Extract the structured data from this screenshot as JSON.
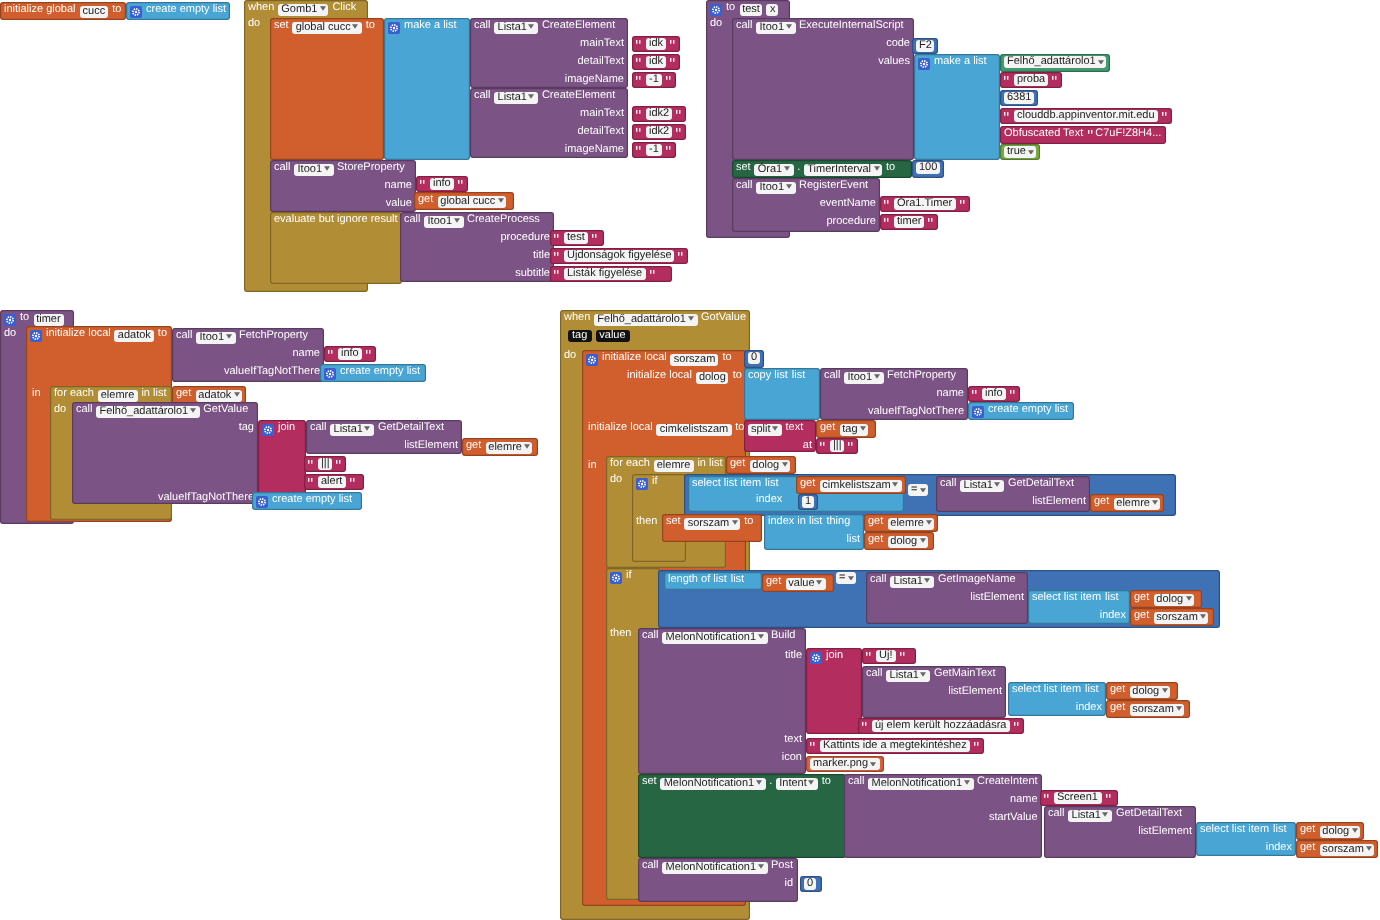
{
  "blocks": [
    {
      "pieces": [
        {
          "kind": "variable",
          "lines": [
            [
              "initialize global",
              {
                "kind": "name",
                "text": "cucc"
              },
              "to"
            ]
          ]
        },
        {
          "kind": "list",
          "lines": [
            [
              {
                "kind": "gear"
              },
              "create empty list"
            ]
          ]
        }
      ]
    },
    {
      "pieces": [
        {
          "kind": "event",
          "lines": [
            [
              "when",
              {
                "kind": "dropdown",
                "text": "Gomb1"
              },
              "Click"
            ],
            [
              "do"
            ]
          ]
        },
        {
          "kind": "variable",
          "lines": [
            [
              "set",
              {
                "kind": "dropdown",
                "text": "global cucc"
              },
              "to"
            ]
          ]
        },
        {
          "kind": "list",
          "lines": [
            [
              {
                "kind": "gear"
              },
              "make a list"
            ]
          ]
        },
        {
          "kind": "call",
          "lines": [
            [
              "call",
              {
                "kind": "dropdown",
                "text": "Lista1"
              },
              "CreateElement"
            ],
            [
              "mainText"
            ],
            [
              "detailText"
            ],
            [
              "imageName"
            ]
          ]
        },
        {
          "kind": "string",
          "text": "idk"
        },
        {
          "kind": "string",
          "text": "idk"
        },
        {
          "kind": "string",
          "text": "-1"
        },
        {
          "kind": "call",
          "lines": [
            [
              "call",
              {
                "kind": "dropdown",
                "text": "Lista1"
              },
              "CreateElement"
            ],
            [
              "mainText"
            ],
            [
              "detailText"
            ],
            [
              "imageName"
            ]
          ]
        },
        {
          "kind": "string",
          "text": "idk2"
        },
        {
          "kind": "string",
          "text": "idk2"
        },
        {
          "kind": "string",
          "text": "-1"
        },
        {
          "kind": "call",
          "lines": [
            [
              "call",
              {
                "kind": "dropdown",
                "text": "Itoo1"
              },
              "StoreProperty"
            ],
            [
              "name"
            ],
            [
              "value"
            ]
          ]
        },
        {
          "kind": "string",
          "text": "info"
        },
        {
          "kind": "variable",
          "lines": [
            [
              "get",
              {
                "kind": "dropdown",
                "text": "global cucc"
              }
            ]
          ]
        },
        {
          "kind": "control",
          "lines": [
            [
              "evaluate but ignore result"
            ]
          ]
        },
        {
          "kind": "call",
          "lines": [
            [
              "call",
              {
                "kind": "dropdown",
                "text": "Itoo1"
              },
              "CreateProcess"
            ],
            [
              "procedure"
            ],
            [
              "title"
            ],
            [
              "subtitle"
            ]
          ]
        },
        {
          "kind": "string",
          "text": "test"
        },
        {
          "kind": "string",
          "text": "Újdonságok figyelése"
        },
        {
          "kind": "string",
          "text": "Listák figyelése"
        }
      ]
    },
    {
      "pieces": [
        {
          "kind": "procedure",
          "lines": [
            [
              {
                "kind": "gear"
              },
              "to",
              {
                "kind": "name",
                "text": "test"
              },
              {
                "kind": "name",
                "text": "x"
              }
            ],
            [
              "do"
            ]
          ]
        },
        {
          "kind": "call",
          "lines": [
            [
              "call",
              {
                "kind": "dropdown",
                "text": "Itoo1"
              },
              "ExecuteInternalScript"
            ],
            [
              "code"
            ],
            [
              "values"
            ]
          ]
        },
        {
          "kind": "math",
          "text": "F2"
        },
        {
          "kind": "list",
          "lines": [
            [
              {
                "kind": "gear"
              },
              "make a list"
            ]
          ]
        },
        {
          "kind": "component",
          "lines": [
            [
              {
                "kind": "dropdown",
                "text": "Felhő_adattárolo1"
              }
            ]
          ]
        },
        {
          "kind": "string",
          "text": "proba"
        },
        {
          "kind": "math",
          "text": "6381"
        },
        {
          "kind": "string",
          "text": "clouddb.appinventor.mit.edu"
        },
        {
          "kind": "text",
          "lines": [
            [
              "Obfuscated Text",
              {
                "kind": "string",
                "text": "C7uF!Z8H4..."
              }
            ]
          ]
        },
        {
          "kind": "logic",
          "lines": [
            [
              {
                "kind": "dropdown",
                "text": "true"
              }
            ]
          ]
        },
        {
          "kind": "setter",
          "lines": [
            [
              "set",
              {
                "kind": "dropdown",
                "text": "Óra1"
              },
              ".",
              {
                "kind": "dropdown",
                "text": "TimerInterval"
              },
              "to"
            ]
          ]
        },
        {
          "kind": "math",
          "text": "100"
        },
        {
          "kind": "call",
          "lines": [
            [
              "call",
              {
                "kind": "dropdown",
                "text": "Itoo1"
              },
              "RegisterEvent"
            ],
            [
              "eventName"
            ],
            [
              "procedure"
            ]
          ]
        },
        {
          "kind": "string",
          "text": "Óra1.Timer"
        },
        {
          "kind": "string",
          "text": "timer"
        }
      ]
    },
    {
      "pieces": [
        {
          "kind": "procedure",
          "lines": [
            [
              {
                "kind": "gear"
              },
              "to",
              {
                "kind": "name",
                "text": "timer"
              }
            ],
            [
              "do"
            ]
          ]
        },
        {
          "kind": "variable",
          "lines": [
            [
              {
                "kind": "gear"
              },
              "initialize local",
              {
                "kind": "name",
                "text": "adatok"
              },
              "to"
            ],
            [
              "in"
            ]
          ]
        },
        {
          "kind": "call",
          "lines": [
            [
              "call",
              {
                "kind": "dropdown",
                "text": "Itoo1"
              },
              "FetchProperty"
            ],
            [
              "name"
            ],
            [
              "valueIfTagNotThere"
            ]
          ]
        },
        {
          "kind": "string",
          "text": "info"
        },
        {
          "kind": "list",
          "lines": [
            [
              {
                "kind": "gear"
              },
              "create empty list"
            ]
          ]
        },
        {
          "kind": "control",
          "lines": [
            [
              "for each",
              {
                "kind": "name",
                "text": "elemre"
              },
              "in list"
            ],
            [
              "do"
            ]
          ]
        },
        {
          "kind": "variable",
          "lines": [
            [
              "get",
              {
                "kind": "dropdown",
                "text": "adatok"
              }
            ]
          ]
        },
        {
          "kind": "call",
          "lines": [
            [
              "call",
              {
                "kind": "dropdown",
                "text": "Felhő_adattárolo1"
              },
              "GetValue"
            ],
            [
              "tag"
            ],
            [
              "valueIfTagNotThere"
            ]
          ]
        },
        {
          "kind": "text",
          "lines": [
            [
              {
                "kind": "gear"
              },
              "join"
            ]
          ]
        },
        {
          "kind": "call",
          "lines": [
            [
              "call",
              {
                "kind": "dropdown",
                "text": "Lista1"
              },
              "GetDetailText"
            ],
            [
              "listElement"
            ]
          ]
        },
        {
          "kind": "variable",
          "lines": [
            [
              "get",
              {
                "kind": "dropdown",
                "text": "elemre"
              }
            ]
          ]
        },
        {
          "kind": "string",
          "text": "|||"
        },
        {
          "kind": "string",
          "text": "alert"
        },
        {
          "kind": "list",
          "lines": [
            [
              {
                "kind": "gear"
              },
              "create empty list"
            ]
          ]
        }
      ]
    },
    {
      "pieces": [
        {
          "kind": "event",
          "lines": [
            [
              "when",
              {
                "kind": "dropdown",
                "text": "Felhő_adattárolo1"
              },
              "GotValue"
            ],
            [
              {
                "kind": "param",
                "text": "tag"
              },
              {
                "kind": "param",
                "text": "value"
              }
            ],
            [
              "do"
            ]
          ]
        },
        {
          "kind": "variable",
          "lines": [
            [
              {
                "kind": "gear"
              },
              "initialize local",
              {
                "kind": "name",
                "text": "sorszam"
              },
              "to"
            ],
            [
              "initialize local",
              {
                "kind": "name",
                "text": "dolog"
              },
              "to"
            ],
            [
              "initialize local",
              {
                "kind": "name",
                "text": "cimkelistszam"
              },
              "to"
            ],
            [
              "in"
            ]
          ]
        },
        {
          "kind": "math",
          "text": "0"
        },
        {
          "kind": "list",
          "lines": [
            [
              "copy list",
              "list"
            ]
          ]
        },
        {
          "kind": "call",
          "lines": [
            [
              "call",
              {
                "kind": "dropdown",
                "text": "Itoo1"
              },
              "FetchProperty"
            ],
            [
              "name"
            ],
            [
              "valueIfTagNotThere"
            ]
          ]
        },
        {
          "kind": "string",
          "text": "info"
        },
        {
          "kind": "list",
          "lines": [
            [
              {
                "kind": "gear"
              },
              "create empty list"
            ]
          ]
        },
        {
          "kind": "text",
          "lines": [
            [
              {
                "kind": "dropdown",
                "text": "split"
              },
              "text"
            ],
            [
              "at"
            ]
          ]
        },
        {
          "kind": "variable",
          "lines": [
            [
              "get",
              {
                "kind": "dropdown",
                "text": "tag"
              }
            ]
          ]
        },
        {
          "kind": "string",
          "text": "|||"
        },
        {
          "kind": "control",
          "lines": [
            [
              "for each",
              {
                "kind": "name",
                "text": "elemre"
              },
              "in list"
            ],
            [
              "do"
            ]
          ]
        },
        {
          "kind": "variable",
          "lines": [
            [
              "get",
              {
                "kind": "dropdown",
                "text": "dolog"
              }
            ]
          ]
        },
        {
          "kind": "control",
          "lines": [
            [
              {
                "kind": "gear"
              },
              "if"
            ],
            [
              "then"
            ]
          ]
        },
        {
          "kind": "list",
          "lines": [
            [
              "select list item",
              "list"
            ],
            [
              "index"
            ]
          ]
        },
        {
          "kind": "variable",
          "lines": [
            [
              "get",
              {
                "kind": "dropdown",
                "text": "cimkelistszam"
              }
            ]
          ]
        },
        {
          "kind": "math",
          "text": "1"
        },
        {
          "kind": "compare",
          "lines": [
            [
              {
                "kind": "dropdown",
                "text": "="
              }
            ]
          ]
        },
        {
          "kind": "call",
          "lines": [
            [
              "call",
              {
                "kind": "dropdown",
                "text": "Lista1"
              },
              "GetDetailText"
            ],
            [
              "listElement"
            ]
          ]
        },
        {
          "kind": "variable",
          "lines": [
            [
              "get",
              {
                "kind": "dropdown",
                "text": "elemre"
              }
            ]
          ]
        },
        {
          "kind": "variable",
          "lines": [
            [
              "set",
              {
                "kind": "dropdown",
                "text": "sorszam"
              },
              "to"
            ]
          ]
        },
        {
          "kind": "list",
          "lines": [
            [
              "index in list",
              "thing"
            ],
            [
              "list"
            ]
          ]
        },
        {
          "kind": "variable",
          "lines": [
            [
              "get",
              {
                "kind": "dropdown",
                "text": "elemre"
              }
            ]
          ]
        },
        {
          "kind": "variable",
          "lines": [
            [
              "get",
              {
                "kind": "dropdown",
                "text": "dolog"
              }
            ]
          ]
        },
        {
          "kind": "control",
          "lines": [
            [
              {
                "kind": "gear"
              },
              "if"
            ],
            [
              "then"
            ]
          ]
        },
        {
          "kind": "list",
          "lines": [
            [
              "length of list",
              "list"
            ]
          ]
        },
        {
          "kind": "variable",
          "lines": [
            [
              "get",
              {
                "kind": "dropdown",
                "text": "value"
              }
            ]
          ]
        },
        {
          "kind": "compare",
          "lines": [
            [
              {
                "kind": "dropdown",
                "text": "="
              }
            ]
          ]
        },
        {
          "kind": "call",
          "lines": [
            [
              "call",
              {
                "kind": "dropdown",
                "text": "Lista1"
              },
              "GetImageName"
            ],
            [
              "listElement"
            ]
          ]
        },
        {
          "kind": "list",
          "lines": [
            [
              "select list item",
              "list"
            ],
            [
              "index"
            ]
          ]
        },
        {
          "kind": "variable",
          "lines": [
            [
              "get",
              {
                "kind": "dropdown",
                "text": "dolog"
              }
            ]
          ]
        },
        {
          "kind": "variable",
          "lines": [
            [
              "get",
              {
                "kind": "dropdown",
                "text": "sorszam"
              }
            ]
          ]
        },
        {
          "kind": "call",
          "lines": [
            [
              "call",
              {
                "kind": "dropdown",
                "text": "MelonNotification1"
              },
              "Build"
            ],
            [
              "title"
            ],
            [
              "text"
            ],
            [
              "icon"
            ]
          ]
        },
        {
          "kind": "text",
          "lines": [
            [
              {
                "kind": "gear"
              },
              "join"
            ]
          ]
        },
        {
          "kind": "string",
          "text": "Új!"
        },
        {
          "kind": "call",
          "lines": [
            [
              "call",
              {
                "kind": "dropdown",
                "text": "Lista1"
              },
              "GetMainText"
            ],
            [
              "listElement"
            ]
          ]
        },
        {
          "kind": "list",
          "lines": [
            [
              "select list item",
              "list"
            ],
            [
              "index"
            ]
          ]
        },
        {
          "kind": "variable",
          "lines": [
            [
              "get",
              {
                "kind": "dropdown",
                "text": "dolog"
              }
            ]
          ]
        },
        {
          "kind": "variable",
          "lines": [
            [
              "get",
              {
                "kind": "dropdown",
                "text": "sorszam"
              }
            ]
          ]
        },
        {
          "kind": "string",
          "text": "új elem került hozzáadásra"
        },
        {
          "kind": "string",
          "text": "Kattints ide a megtekintéshez"
        },
        {
          "kind": "asset",
          "lines": [
            [
              {
                "kind": "dropdown",
                "text": "marker.png"
              }
            ]
          ]
        },
        {
          "kind": "setter",
          "lines": [
            [
              "set",
              {
                "kind": "dropdown",
                "text": "MelonNotification1"
              },
              ".",
              {
                "kind": "dropdown",
                "text": "Intent"
              },
              "to"
            ]
          ]
        },
        {
          "kind": "call",
          "lines": [
            [
              "call",
              {
                "kind": "dropdown",
                "text": "MelonNotification1"
              },
              "CreateIntent"
            ],
            [
              "name"
            ],
            [
              "startValue"
            ]
          ]
        },
        {
          "kind": "string",
          "text": "Screen1"
        },
        {
          "kind": "call",
          "lines": [
            [
              "call",
              {
                "kind": "dropdown",
                "text": "Lista1"
              },
              "GetDetailText"
            ],
            [
              "listElement"
            ]
          ]
        },
        {
          "kind": "list",
          "lines": [
            [
              "select list item",
              "list"
            ],
            [
              "index"
            ]
          ]
        },
        {
          "kind": "variable",
          "lines": [
            [
              "get",
              {
                "kind": "dropdown",
                "text": "dolog"
              }
            ]
          ]
        },
        {
          "kind": "variable",
          "lines": [
            [
              "get",
              {
                "kind": "dropdown",
                "text": "sorszam"
              }
            ]
          ]
        },
        {
          "kind": "call",
          "lines": [
            [
              "call",
              {
                "kind": "dropdown",
                "text": "MelonNotification1"
              },
              "Post"
            ],
            [
              "id"
            ]
          ]
        },
        {
          "kind": "math",
          "text": "0"
        }
      ]
    }
  ]
}
